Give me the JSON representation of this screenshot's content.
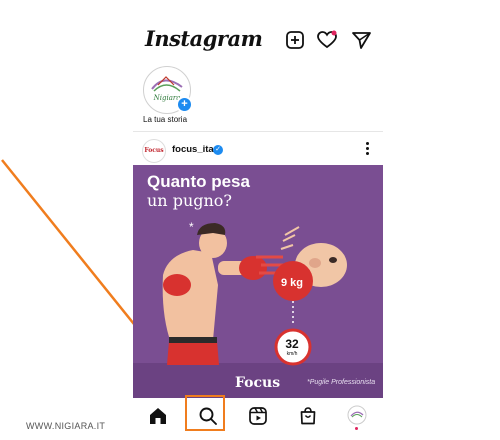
{
  "header": {
    "logo": "Instagram",
    "icons": [
      "new-post-icon",
      "activity-heart-icon",
      "direct-message-icon"
    ]
  },
  "stories": {
    "own_label": "La tua storia",
    "avatar_text": "Nigiara"
  },
  "post": {
    "username": "focus_ita",
    "verified": true,
    "avatar_text": "Focus",
    "image": {
      "headline": "Quanto pesa",
      "subline": "un pugno?",
      "weight": "9 kg",
      "speed_value": "32",
      "speed_unit": "km/h",
      "brand": "Focus",
      "credit": "*Pugile Professionista",
      "footnote_star": "*"
    }
  },
  "bottom_nav": {
    "items": [
      "home-icon",
      "search-icon",
      "reels-icon",
      "shop-icon",
      "profile-avatar"
    ],
    "highlighted": "search-icon"
  },
  "watermark": "WWW.NIGIARA.IT",
  "colors": {
    "post_bg": "#7a4e92",
    "annotation": "#f07d1e",
    "verified": "#1d8bf0",
    "notification": "#e0245e"
  }
}
